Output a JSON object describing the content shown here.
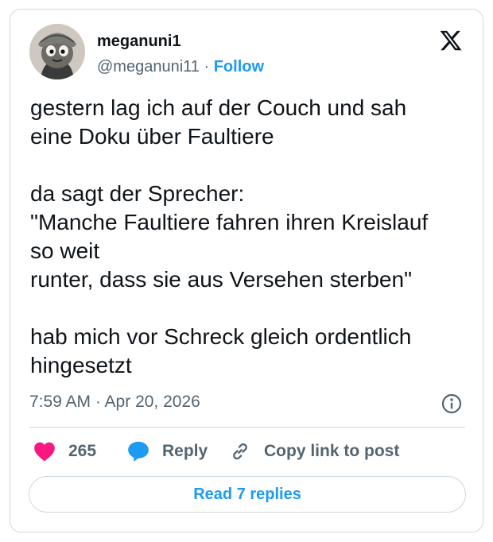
{
  "author": {
    "display_name": "meganuni1",
    "handle": "@meganuni11",
    "separator": "·",
    "follow_label": "Follow"
  },
  "brand": {
    "logo_icon": "x-logo-icon"
  },
  "tweet": {
    "lines": [
      "gestern lag ich auf der Couch und sah",
      "eine Doku über Faultiere",
      "",
      "da sagt der Sprecher:",
      "\"Manche Faultiere fahren ihren Kreislauf",
      "so weit",
      "runter, dass sie aus Versehen sterben\"",
      "",
      "hab mich vor Schreck gleich ordentlich",
      "hingesetzt"
    ],
    "timestamp": "7:59 AM · Apr 20, 2026",
    "info_icon": "info-icon"
  },
  "actions": {
    "like_count": "265",
    "reply_label": "Reply",
    "copy_link_label": "Copy link to post",
    "read_replies_label": "Read 7 replies"
  },
  "colors": {
    "like": "#f91880",
    "reply": "#1d9bf0",
    "link": "#1d9bf0",
    "text": "#0f1419",
    "muted": "#536471",
    "border": "#cfd9de"
  }
}
